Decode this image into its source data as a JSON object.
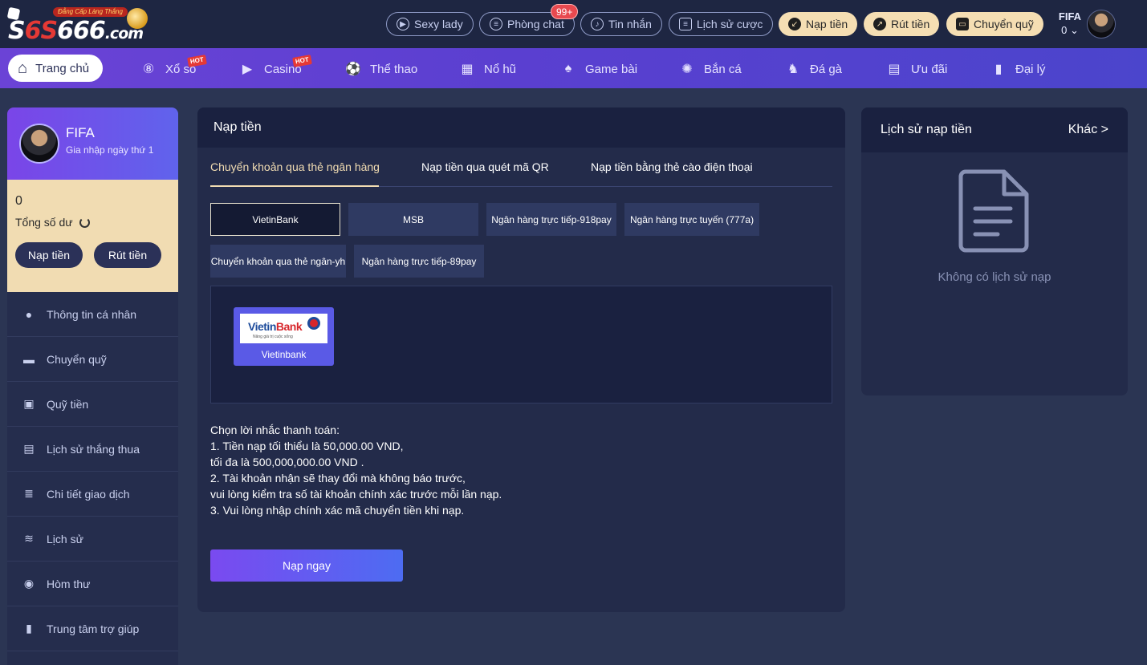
{
  "logo": {
    "slogan": "Đẳng Cấp Làng Thắng",
    "brand_prefix": "S",
    "brand_mid": "6S",
    "brand_main": "666",
    "brand_suffix": ".com"
  },
  "header": {
    "buttons": [
      {
        "label": "Sexy lady",
        "icon": "play-circle-icon"
      },
      {
        "label": "Phòng chat",
        "icon": "chat-icon"
      },
      {
        "label": "Tin nhắn",
        "icon": "bell-icon"
      },
      {
        "label": "Lịch sử cược",
        "icon": "list-icon"
      }
    ],
    "chat_badge": "99+",
    "actions": [
      {
        "label": "Nạp tiền",
        "icon": "arrow-down-left-icon"
      },
      {
        "label": "Rút tiền",
        "icon": "arrow-up-right-icon"
      },
      {
        "label": "Chuyển quỹ",
        "icon": "wallet-icon"
      }
    ],
    "user": {
      "name": "FIFA",
      "balance": "0"
    }
  },
  "nav": {
    "items": [
      {
        "label": "Trang chủ",
        "icon": "home-icon"
      },
      {
        "label": "Xổ số",
        "icon": "lottery-icon",
        "hot": "HOT"
      },
      {
        "label": "Casino",
        "icon": "casino-icon",
        "hot": "HOT"
      },
      {
        "label": "Thể thao",
        "icon": "soccer-icon"
      },
      {
        "label": "Nổ hũ",
        "icon": "slots-icon"
      },
      {
        "label": "Game bài",
        "icon": "cards-icon"
      },
      {
        "label": "Bắn cá",
        "icon": "fish-icon"
      },
      {
        "label": "Đá gà",
        "icon": "rooster-icon"
      },
      {
        "label": "Ưu đãi",
        "icon": "gift-icon"
      },
      {
        "label": "Đại lý",
        "icon": "agent-icon"
      }
    ]
  },
  "sidebar": {
    "name": "FIFA",
    "join": "Gia nhập ngày thứ 1",
    "balance": "0",
    "total_label": "Tổng số dư",
    "deposit": "Nạp tiền",
    "withdraw": "Rút tiền",
    "menu": [
      {
        "label": "Thông tin cá nhân",
        "icon": "user-icon"
      },
      {
        "label": "Chuyển quỹ",
        "icon": "wallet-icon"
      },
      {
        "label": "Quỹ tiền",
        "icon": "fund-icon"
      },
      {
        "label": "Lịch sử thắng thua",
        "icon": "clipboard-icon"
      },
      {
        "label": "Chi tiết giao dịch",
        "icon": "bars-icon"
      },
      {
        "label": "Lịch sử",
        "icon": "coins-icon"
      },
      {
        "label": "Hòm thư",
        "icon": "mailbox-icon"
      },
      {
        "label": "Trung tâm trợ giúp",
        "icon": "book-icon"
      }
    ]
  },
  "main": {
    "title": "Nạp tiền",
    "tabs": [
      {
        "label": "Chuyển khoản qua thẻ ngân hàng",
        "active": true
      },
      {
        "label": "Nạp tiền qua quét mã QR",
        "active": false
      },
      {
        "label": "Nạp tiền bằng thẻ cào điện thoại",
        "active": false
      }
    ],
    "bank_options": [
      {
        "label": "VietinBank",
        "selected": true
      },
      {
        "label": "MSB",
        "selected": false
      },
      {
        "label": "Ngân hàng trực tiếp-918pay",
        "selected": false
      },
      {
        "label": "Ngân hàng trực tuyến  (777a)",
        "selected": false
      },
      {
        "label": "Chuyển khoản qua thẻ ngân-yh",
        "selected": false
      },
      {
        "label": "Ngân hàng trực tiếp-89pay",
        "selected": false
      }
    ],
    "bank_tile": {
      "logo_text_a": "Vietin",
      "logo_text_b": "Bank",
      "tagline": "Nâng giá trị cuộc sống",
      "label": "Vietinbank"
    },
    "notes": [
      "Chọn lời nhắc thanh toán:",
      "1. Tiền nạp tối thiểu là 50,000.00 VND,",
      "tối đa là 500,000,000.00 VND .",
      "2. Tài khoản nhận sẽ thay đổi mà không báo trước,",
      "vui lòng kiểm tra số tài khoản chính xác trước mỗi lần nạp.",
      "3. Vui lòng nhập chính xác mã chuyển tiền khi nạp."
    ],
    "submit": "Nạp ngay"
  },
  "history": {
    "title": "Lịch sử nạp tiền",
    "more": "Khác >",
    "empty": "Không có lịch sử nạp"
  },
  "colors": {
    "gold": "#f1dcb2",
    "purple": "#6b43d6",
    "badge_red": "#e8494f"
  }
}
